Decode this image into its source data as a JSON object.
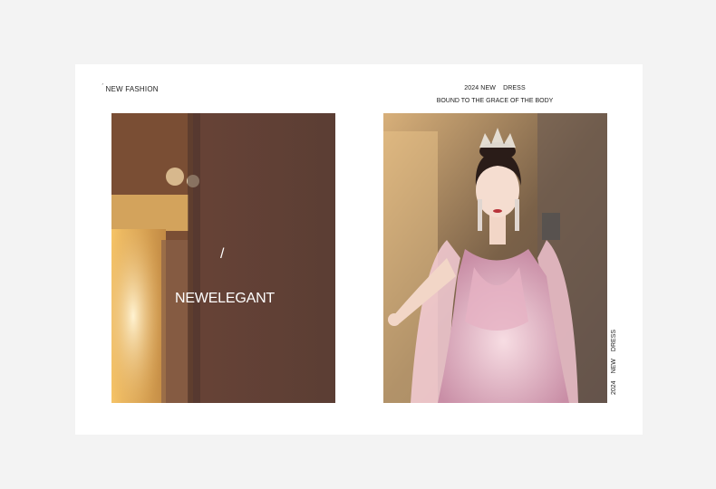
{
  "header": {
    "left_label": "NEW FASHION",
    "right_title": "2024 NEW    DRESS",
    "right_subtitle": "BOUND TO THE GRACE OF THE BODY"
  },
  "left_panel": {
    "slash": "/",
    "headline": "NEWELEGANT"
  },
  "side_vertical": {
    "year": "2024",
    "new": "NEW",
    "dress": "DRESS"
  },
  "colors": {
    "page_bg": "#f3f3f3",
    "card_bg": "#ffffff",
    "left_photo_tone": "#5e4137",
    "dress_pink": "#e9b9c6"
  }
}
